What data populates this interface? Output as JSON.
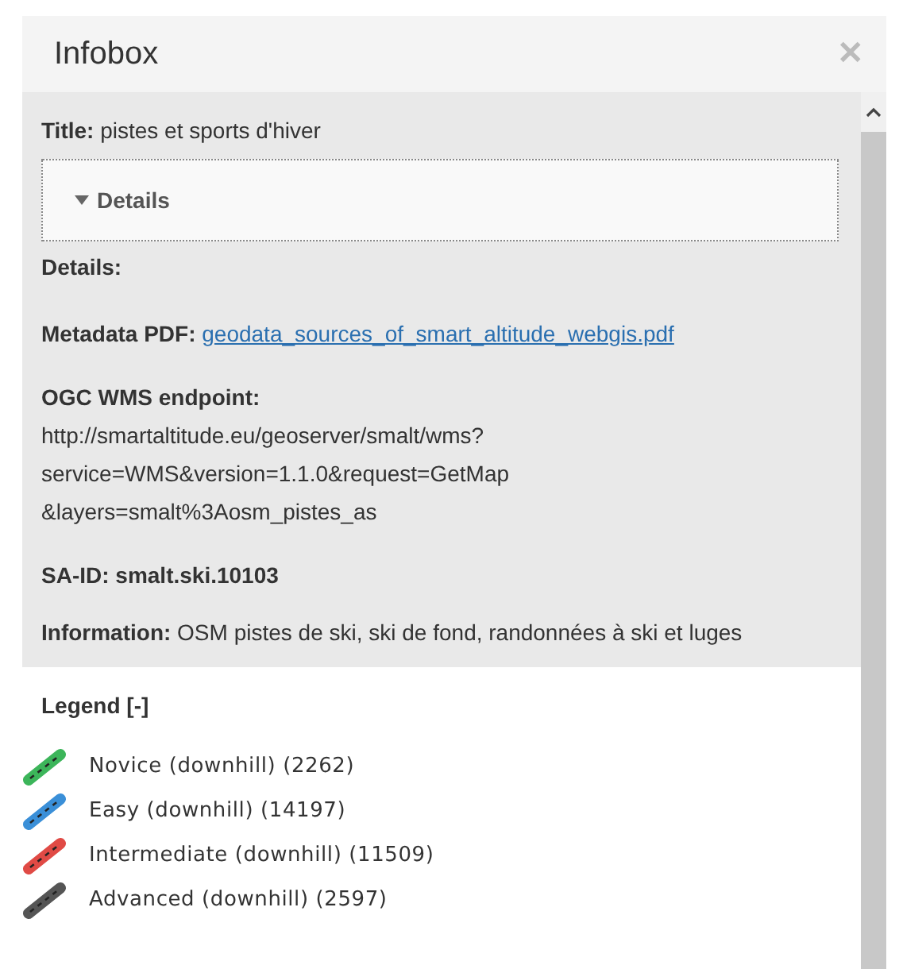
{
  "window": {
    "title": "Infobox",
    "close": "✕"
  },
  "info": {
    "title_label": "Title:",
    "title_value": "pistes et sports d'hiver",
    "details_toggle": {
      "label": "Details",
      "expanded": true
    },
    "details_heading": "Details:",
    "metadata_label": "Metadata PDF:",
    "metadata_link": "geodata_sources_of_smart_altitude_webgis.pdf",
    "endpoint_label": "OGC WMS endpoint:",
    "endpoint_lines": [
      "http://smartaltitude.eu/geoserver/smalt/wms?",
      "service=WMS&version=1.1.0&request=GetMap",
      "&layers=smalt%3Aosm_pistes_as"
    ],
    "said": "SA-ID: smalt.ski.10103",
    "information_label": "Information:",
    "information_value": "OSM pistes de ski, ski de fond, randonnées à ski et luges"
  },
  "legend": {
    "heading": "Legend [-]",
    "items": [
      {
        "label": "Novice (downhill) (2262)",
        "color": "#3cb55a"
      },
      {
        "label": "Easy (downhill) (14197)",
        "color": "#3a8fd8"
      },
      {
        "label": "Intermediate (downhill) (11509)",
        "color": "#e04a45"
      },
      {
        "label": "Advanced (downhill) (2597)",
        "color": "#555555"
      }
    ]
  }
}
